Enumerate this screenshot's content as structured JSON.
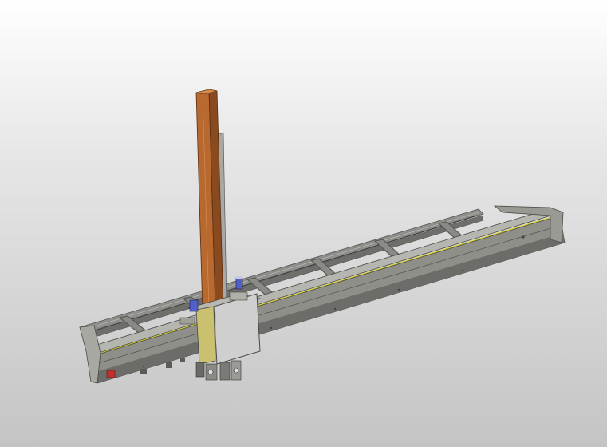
{
  "scene": {
    "subject": "gantry-robot-assembly",
    "colors": {
      "background_top": "#ffffff",
      "background_bottom": "#c4c4c4",
      "rail_body": "#9a9a96",
      "rail_dark": "#5c5c58",
      "rail_light": "#c8c8c2",
      "yellow_stripe": "#d8cf2a",
      "column_orange": "#b8692f",
      "column_orange_dark": "#8a4a1f",
      "carriage_body": "#cfcfcf",
      "carriage_yellow": "#c9c070",
      "accent_blue": "#5060c8",
      "accent_red": "#c03030"
    }
  }
}
